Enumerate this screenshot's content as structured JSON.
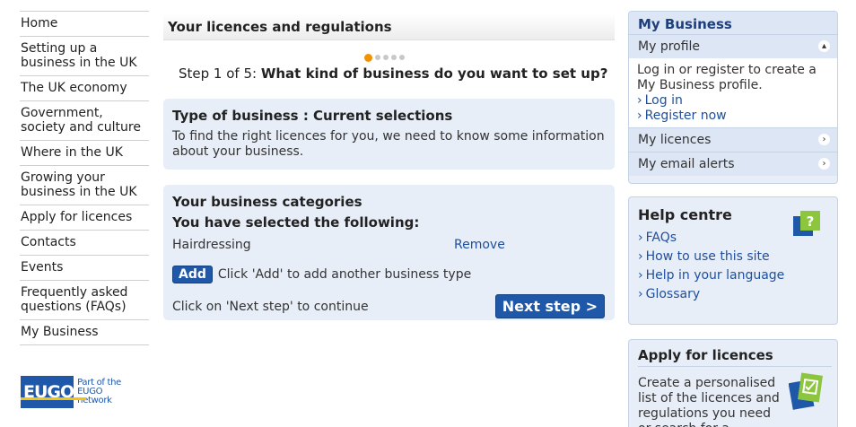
{
  "nav": {
    "items": [
      {
        "label": "Home"
      },
      {
        "label": "Setting up a business in the UK"
      },
      {
        "label": "The UK economy"
      },
      {
        "label": "Government, society and culture"
      },
      {
        "label": "Where in the UK"
      },
      {
        "label": "Growing your business in the UK"
      },
      {
        "label": "Apply for licences"
      },
      {
        "label": "Contacts"
      },
      {
        "label": "Events"
      },
      {
        "label": "Frequently asked questions (FAQs)"
      },
      {
        "label": "My Business"
      }
    ],
    "logo": {
      "brand": "EUGO",
      "tagline": "Part of the EUGO network"
    }
  },
  "main": {
    "title": "Your licences and regulations",
    "progress": {
      "current": 1,
      "total": 5
    },
    "step_prefix": "Step 1 of 5: ",
    "step_question": "What kind of business do you want to set up?",
    "current_selections": {
      "heading": "Type of business : Current selections",
      "text": "To find the right licences for you, we need to know some information about your business."
    },
    "categories": {
      "heading": "Your business categories",
      "subheading": "You have selected the following:",
      "selected": [
        {
          "name": "Hairdressing",
          "remove_label": "Remove"
        }
      ],
      "add_label": "Add",
      "add_hint": "Click 'Add' to add another business type",
      "next_hint": "Click on 'Next step' to continue",
      "next_label": "Next step >"
    }
  },
  "my_business": {
    "title": "My Business",
    "profile_label": "My profile",
    "profile_text": "Log in or register to create a My Business profile.",
    "login_label": "Log in",
    "register_label": "Register now",
    "licences_label": "My licences",
    "alerts_label": "My email alerts"
  },
  "help": {
    "title": "Help centre",
    "links": [
      {
        "label": "FAQs"
      },
      {
        "label": "How to use this site"
      },
      {
        "label": "Help in your language"
      },
      {
        "label": "Glossary"
      }
    ]
  },
  "apply": {
    "title": "Apply for licences",
    "text": "Create a personalised list of the licences and regulations you need or search for a"
  },
  "colors": {
    "accent": "#1f58a8",
    "panel_bg": "#e8eef8",
    "progress_active": "#f39200",
    "link": "#1f4f9c"
  }
}
